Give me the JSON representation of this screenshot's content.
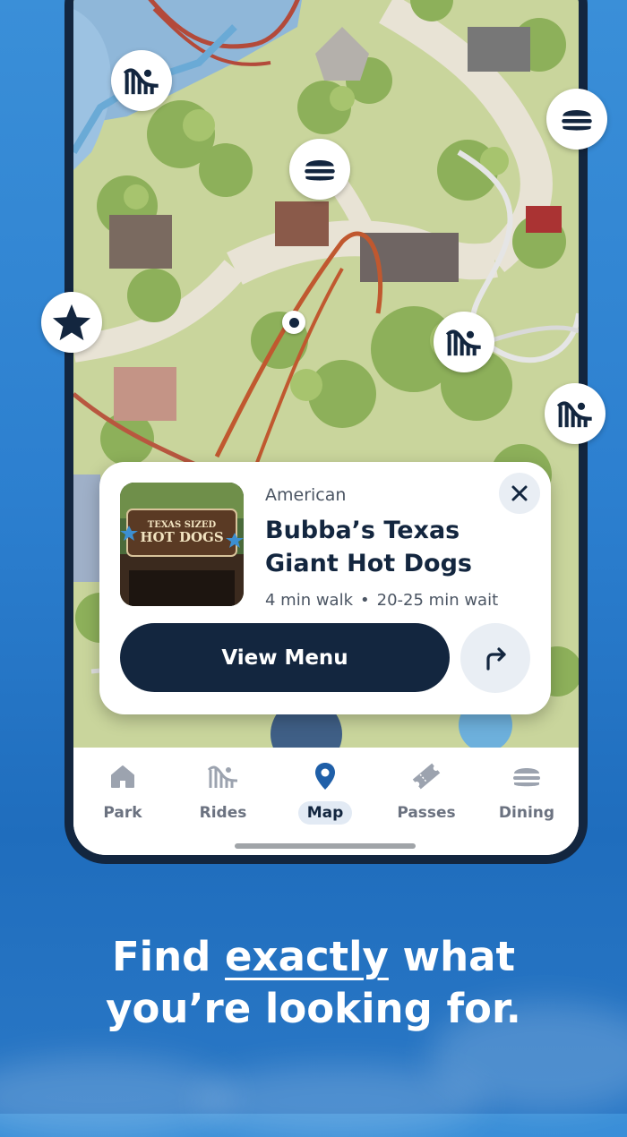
{
  "poi": {
    "category": "American",
    "name": "Bubba’s Texas Giant Hot Dogs",
    "walk": "4 min walk",
    "separator": "•",
    "wait": "20-25 min wait",
    "primary_button": "View Menu",
    "image_sign_line1": "TEXAS SIZED",
    "image_sign_line2": "HOT DOGS"
  },
  "tabs": [
    {
      "label": "Park",
      "icon": "home-icon",
      "active": false
    },
    {
      "label": "Rides",
      "icon": "coaster-icon",
      "active": false
    },
    {
      "label": "Map",
      "icon": "map-pin-icon",
      "active": true
    },
    {
      "label": "Passes",
      "icon": "ticket-icon",
      "active": false
    },
    {
      "label": "Dining",
      "icon": "burger-icon",
      "active": false
    }
  ],
  "headline": {
    "line1_before": "Find ",
    "line1_emph": "exactly",
    "line1_after": " what",
    "line2": "you’re looking for."
  },
  "colors": {
    "navy": "#13263f",
    "background_blue": "#2c7fcf",
    "map_green": "#c7d49a",
    "tab_active_bg": "#e2eaf4"
  }
}
